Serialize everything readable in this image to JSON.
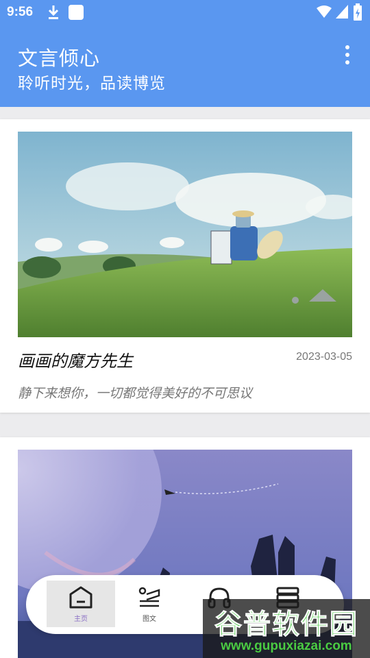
{
  "status": {
    "time": "9:56"
  },
  "app": {
    "title": "文言倾心",
    "subtitle": "聆听时光，品读博览"
  },
  "cards": [
    {
      "title": "画画的魔方先生",
      "date": "2023-03-05",
      "desc": "静下来想你，一切都觉得美好的不可思议",
      "image": "landscape-illustration"
    },
    {
      "title": "",
      "date": "",
      "desc": "",
      "image": "night-sky-illustration"
    }
  ],
  "nav": {
    "items": [
      {
        "label": "主页",
        "icon": "home-icon",
        "active": true
      },
      {
        "label": "图文",
        "icon": "reading-icon",
        "active": false
      },
      {
        "label": "",
        "icon": "headphones-icon",
        "active": false
      },
      {
        "label": "",
        "icon": "books-icon",
        "active": false
      }
    ]
  },
  "watermark": {
    "main": "谷普软件园",
    "url": "www.gupuxiazai.com"
  },
  "colors": {
    "primary": "#5a97f0",
    "active_nav_text": "#8a6fc4",
    "watermark_green": "#44c43e"
  }
}
